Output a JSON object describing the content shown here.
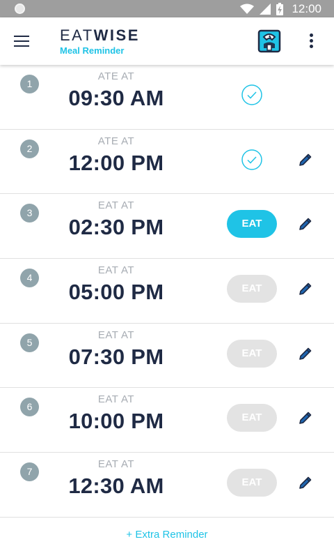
{
  "status_bar": {
    "time": "12:00"
  },
  "header": {
    "brand_light": "EAT",
    "brand_bold": "WISE",
    "subtitle": "Meal Reminder"
  },
  "colors": {
    "accent": "#1fc3e6",
    "navy": "#1f2a44",
    "badge": "#90a4ab",
    "disabled": "#e3e3e3"
  },
  "meals": [
    {
      "number": "1",
      "label": "ATE AT",
      "time": "09:30 AM",
      "status": "done",
      "button": "",
      "editable": false
    },
    {
      "number": "2",
      "label": "ATE AT",
      "time": "12:00 PM",
      "status": "done",
      "button": "",
      "editable": true
    },
    {
      "number": "3",
      "label": "EAT AT",
      "time": "02:30 PM",
      "status": "active",
      "button": "EAT",
      "editable": true
    },
    {
      "number": "4",
      "label": "EAT AT",
      "time": "05:00 PM",
      "status": "disabled",
      "button": "EAT",
      "editable": true
    },
    {
      "number": "5",
      "label": "EAT AT",
      "time": "07:30 PM",
      "status": "disabled",
      "button": "EAT",
      "editable": true
    },
    {
      "number": "6",
      "label": "EAT AT",
      "time": "10:00 PM",
      "status": "disabled",
      "button": "EAT",
      "editable": true
    },
    {
      "number": "7",
      "label": "EAT AT",
      "time": "12:30 AM",
      "status": "disabled",
      "button": "EAT",
      "editable": true
    }
  ],
  "footer": {
    "extra_label": "+ Extra Reminder"
  },
  "icons": {
    "menu": "hamburger-icon",
    "scale": "weighing-scale-icon",
    "more": "more-vertical-icon",
    "check": "check-circle-icon",
    "edit": "pencil-icon"
  }
}
